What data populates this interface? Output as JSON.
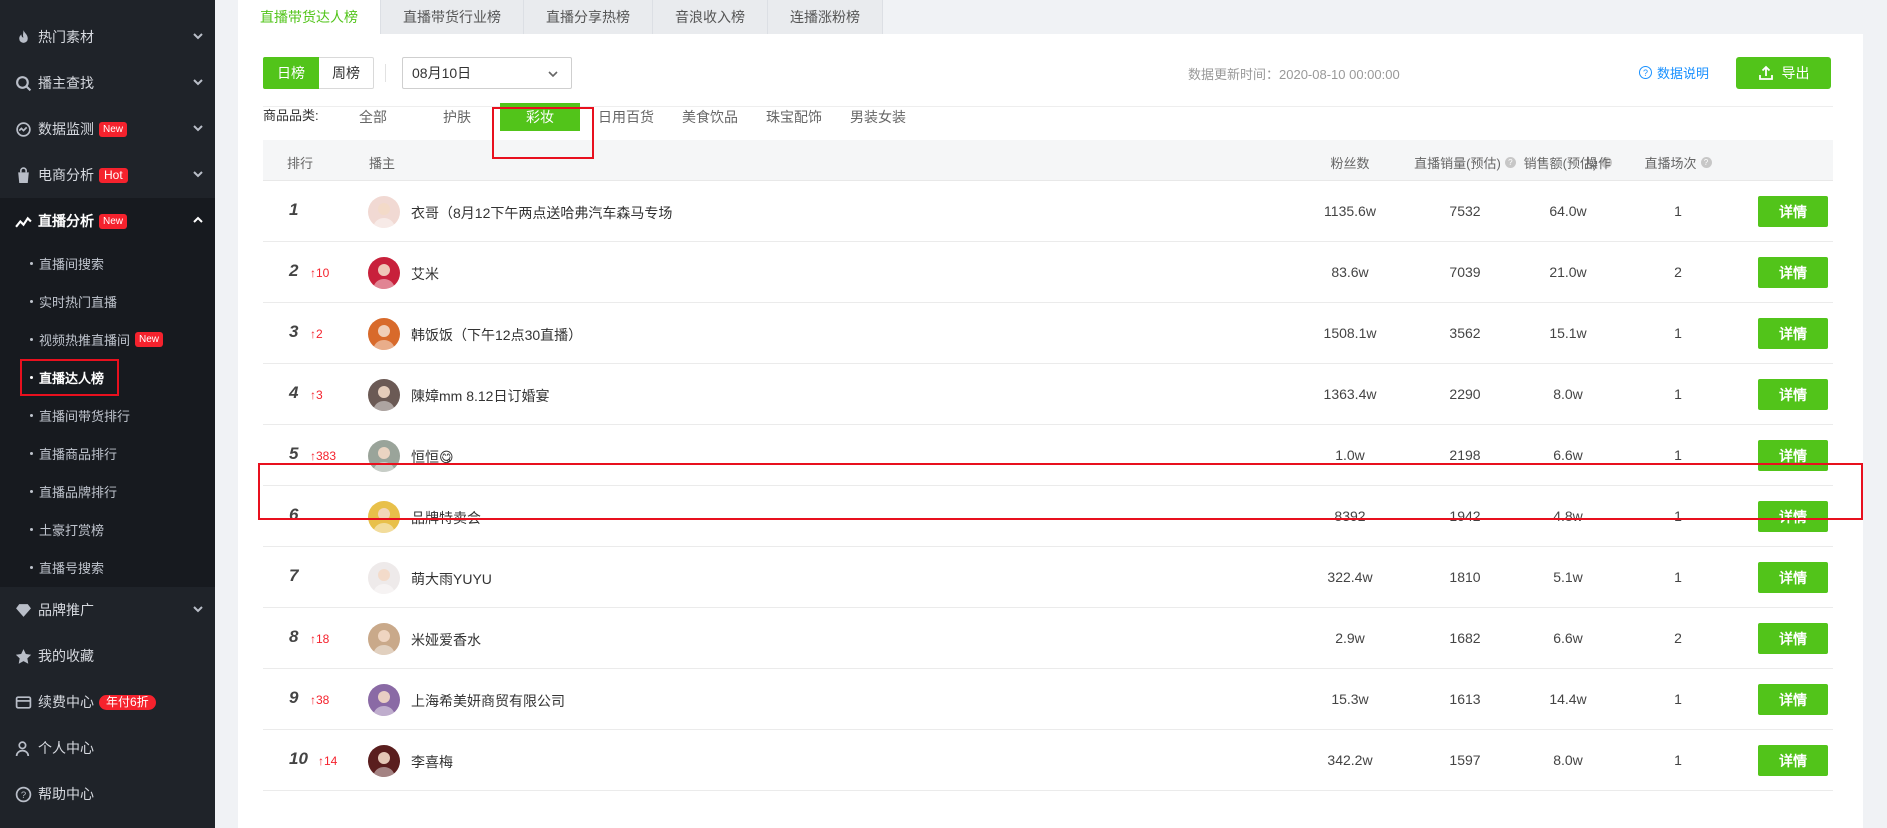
{
  "sidebar": {
    "groups": [
      {
        "label": "热门素材",
        "icon": "fire-icon",
        "badge": ""
      },
      {
        "label": "播主查找",
        "icon": "search-icon",
        "badge": ""
      },
      {
        "label": "数据监测",
        "icon": "monitor-icon",
        "badge": "New"
      },
      {
        "label": "电商分析",
        "icon": "bag-icon",
        "badge": "Hot"
      },
      {
        "label": "直播分析",
        "icon": "trend-icon",
        "badge": "New"
      },
      {
        "label": "品牌推广",
        "icon": "diamond-icon",
        "badge": ""
      },
      {
        "label": "我的收藏",
        "icon": "star-icon",
        "badge": ""
      },
      {
        "label": "续费中心",
        "icon": "wallet-icon",
        "badge": "年付6折"
      },
      {
        "label": "个人中心",
        "icon": "user-icon",
        "badge": ""
      },
      {
        "label": "帮助中心",
        "icon": "help-icon",
        "badge": ""
      }
    ],
    "live_sub": [
      {
        "label": "直播间搜索",
        "badge": ""
      },
      {
        "label": "实时热门直播",
        "badge": ""
      },
      {
        "label": "视频热推直播间",
        "badge": "New"
      },
      {
        "label": "直播达人榜",
        "badge": ""
      },
      {
        "label": "直播间带货排行",
        "badge": ""
      },
      {
        "label": "直播商品排行",
        "badge": ""
      },
      {
        "label": "直播品牌排行",
        "badge": ""
      },
      {
        "label": "土豪打赏榜",
        "badge": ""
      },
      {
        "label": "直播号搜索",
        "badge": ""
      }
    ]
  },
  "tabs": [
    "直播带货达人榜",
    "直播带货行业榜",
    "直播分享热榜",
    "音浪收入榜",
    "连播涨粉榜"
  ],
  "filters": {
    "day": "日榜",
    "week": "周榜",
    "date": "08月10日",
    "update_label": "数据更新时间：2020-08-10 00:00:00",
    "explain": "数据说明",
    "export": "导出",
    "category_label": "商品品类:",
    "categories": [
      "全部",
      "护肤",
      "彩妆",
      "日用百货",
      "美食饮品",
      "珠宝配饰",
      "男装女装"
    ]
  },
  "table": {
    "headers": {
      "rank": "排行",
      "host": "播主",
      "fans": "粉丝数",
      "sales": "直播销量(预估)",
      "amount": "销售额(预估)",
      "sessions": "直播场次",
      "action": "操作"
    },
    "detail_label": "详情",
    "rows": [
      {
        "rank": "1",
        "change": "",
        "name": "衣哥（8月12下午两点送哈弗汽车森马专场",
        "fans": "1135.6w",
        "sales": "7532",
        "amount": "64.0w",
        "sessions": "1",
        "avatar_color": "#f1d9d3"
      },
      {
        "rank": "2",
        "change": "↑10",
        "name": "艾米",
        "fans": "83.6w",
        "sales": "7039",
        "amount": "21.0w",
        "sessions": "2",
        "avatar_color": "#c8203b"
      },
      {
        "rank": "3",
        "change": "↑2",
        "name": "韩饭饭（下午12点30直播）",
        "fans": "1508.1w",
        "sales": "3562",
        "amount": "15.1w",
        "sessions": "1",
        "avatar_color": "#d86a2b"
      },
      {
        "rank": "4",
        "change": "↑3",
        "name": "陳嫜mm 8.12日订婚宴",
        "fans": "1363.4w",
        "sales": "2290",
        "amount": "8.0w",
        "sessions": "1",
        "avatar_color": "#6b5a55"
      },
      {
        "rank": "5",
        "change": "↑383",
        "name": "恒恒😋",
        "fans": "1.0w",
        "sales": "2198",
        "amount": "6.6w",
        "sessions": "1",
        "avatar_color": "#9aa49a"
      },
      {
        "rank": "6",
        "change": "",
        "name": "品牌特卖会",
        "fans": "8392",
        "sales": "1942",
        "amount": "4.8w",
        "sessions": "1",
        "avatar_color": "#e8c04a"
      },
      {
        "rank": "7",
        "change": "",
        "name": "萌大雨YUYU",
        "fans": "322.4w",
        "sales": "1810",
        "amount": "5.1w",
        "sessions": "1",
        "avatar_color": "#eeeaea"
      },
      {
        "rank": "8",
        "change": "↑18",
        "name": "米娅爱香水",
        "fans": "2.9w",
        "sales": "1682",
        "amount": "6.6w",
        "sessions": "2",
        "avatar_color": "#c9a98a"
      },
      {
        "rank": "9",
        "change": "↑38",
        "name": "上海希美妍商贸有限公司",
        "fans": "15.3w",
        "sales": "1613",
        "amount": "14.4w",
        "sessions": "1",
        "avatar_color": "#8a6aa5"
      },
      {
        "rank": "10",
        "change": "↑14",
        "name": "李喜梅",
        "fans": "342.2w",
        "sales": "1597",
        "amount": "8.0w",
        "sessions": "1",
        "avatar_color": "#5a1e1e"
      }
    ]
  },
  "colors": {
    "accent": "#52c41a",
    "sidebar_bg": "#1f2329",
    "badge_red": "#f5222d",
    "highlight_box": "#e8101e",
    "link_blue": "#1890ff"
  }
}
